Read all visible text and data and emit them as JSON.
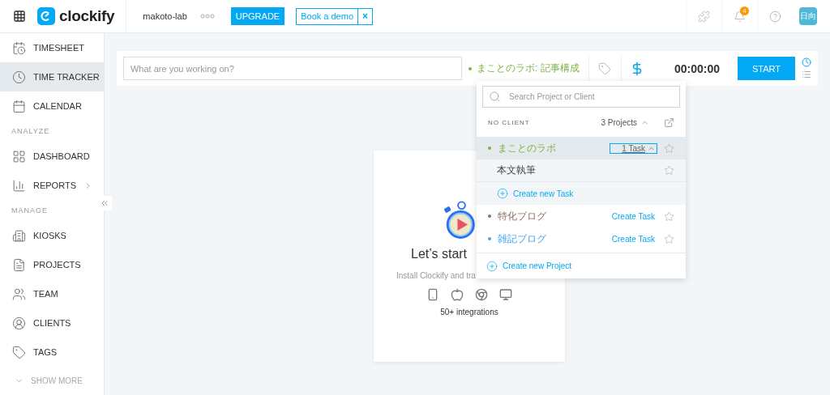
{
  "header": {
    "brand": "clockify",
    "workspace": "makoto-lab",
    "upgrade": "UPGRADE",
    "demo": "Book a demo",
    "demo_close": "×",
    "notifications": "4",
    "avatar": "日向"
  },
  "sidebar": {
    "items": [
      {
        "kind": "item",
        "label": "TIMESHEET",
        "selected": false
      },
      {
        "kind": "item",
        "label": "TIME TRACKER",
        "selected": true
      },
      {
        "kind": "item",
        "label": "CALENDAR",
        "selected": false
      },
      {
        "kind": "section",
        "label": "ANALYZE"
      },
      {
        "kind": "item",
        "label": "DASHBOARD",
        "selected": false
      },
      {
        "kind": "item",
        "label": "REPORTS",
        "selected": false,
        "has_submenu": true
      },
      {
        "kind": "section",
        "label": "MANAGE"
      },
      {
        "kind": "item",
        "label": "KIOSKS",
        "selected": false
      },
      {
        "kind": "item",
        "label": "PROJECTS",
        "selected": false
      },
      {
        "kind": "item",
        "label": "TEAM",
        "selected": false
      },
      {
        "kind": "item",
        "label": "CLIENTS",
        "selected": false
      },
      {
        "kind": "item",
        "label": "TAGS",
        "selected": false
      },
      {
        "kind": "more",
        "label": "SHOW MORE"
      }
    ]
  },
  "tracker": {
    "placeholder": "What are you working on?",
    "project": "まことのラボ: 記事構成",
    "timer": "00:00:00",
    "start": "START",
    "billable": true
  },
  "dropdown": {
    "search_placeholder": "Search Project or Client",
    "group": "NO CLIENT",
    "count": "3 Projects",
    "expanded": true,
    "projects": [
      {
        "name": "まことのラボ",
        "color": "#7cb342",
        "selected": true,
        "expanded": true,
        "task_button": "1 Task",
        "tasks": [
          {
            "name": "本文執筆"
          }
        ],
        "create_task": "Create new Task"
      },
      {
        "name": "特化ブログ",
        "color": "#8d6e63",
        "selected": false,
        "expanded": false,
        "task_button": "Create Task"
      },
      {
        "name": "雑記ブログ",
        "color": "#42a5f5",
        "selected": false,
        "expanded": false,
        "task_button": "Create Task"
      }
    ],
    "create_project": "Create new Project"
  },
  "card": {
    "title": "Let’s start",
    "subtitle": "Install Clockify and tra",
    "integrations": "50+ integrations"
  }
}
